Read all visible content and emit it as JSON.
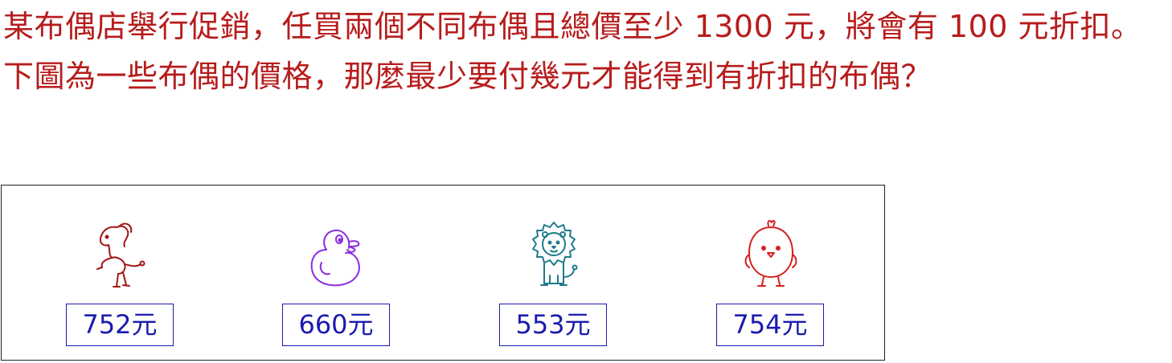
{
  "question": "某布偶店舉行促銷，任買兩個不同布偶且總價至少 1300 元，將會有 100 元折扣。下圖為一些布偶的價格，那麼最少要付幾元才能得到有折扣的布偶？",
  "colors": {
    "question_text": "#b71c1c",
    "price_box": "#1a1ab0",
    "horse": "#a31515",
    "duck": "#8a2be2",
    "lion": "#1f7a8c",
    "chick": "#d61f1f"
  },
  "toys": [
    {
      "icon": "horse-icon",
      "price": "752",
      "unit": "元"
    },
    {
      "icon": "duck-icon",
      "price": "660",
      "unit": "元"
    },
    {
      "icon": "lion-icon",
      "price": "553",
      "unit": "元"
    },
    {
      "icon": "chick-icon",
      "price": "754",
      "unit": "元"
    }
  ]
}
